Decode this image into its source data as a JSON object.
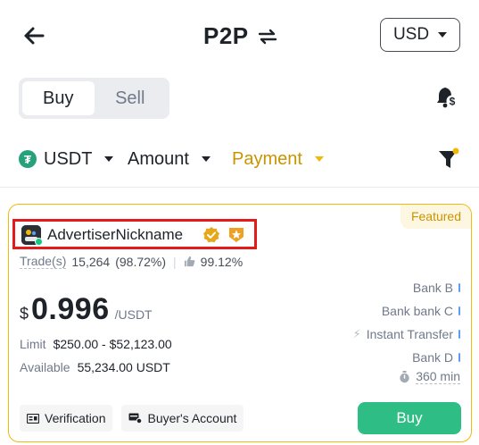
{
  "header": {
    "title": "P2P",
    "currency": "USD"
  },
  "toggle": {
    "buy_label": "Buy",
    "sell_label": "Sell"
  },
  "filters": {
    "asset": "USDT",
    "amount": "Amount",
    "payment": "Payment"
  },
  "card": {
    "featured_label": "Featured",
    "advertiser_name": "AdvertiserNickname",
    "trades_label": "Trade(s)",
    "trades_count": "15,264",
    "completion_rate": "(98.72%)",
    "positive_rate": "99.12%",
    "price_currency_symbol": "$",
    "price": "0.996",
    "price_unit": "/USDT",
    "limit_label": "Limit",
    "limit_value": "$250.00 - $52,123.00",
    "available_label": "Available",
    "available_value": "55,234.00 USDT",
    "payment_methods": [
      "Bank B",
      "Bank bank C",
      "Instant Transfer",
      "Bank D"
    ],
    "payment_time": "360 min",
    "tag_verification": "Verification",
    "tag_buyers_account": "Buyer's Account",
    "buy_button": "Buy"
  },
  "colors": {
    "accent": "#f0b90b",
    "buy_green": "#2ebd85",
    "highlight_red": "#e21b1b",
    "method_bar": "#5a9cf8"
  },
  "icons": [
    "arrow-left-icon",
    "swap-icon",
    "chevron-down-icon",
    "bell-dollar-icon",
    "tether-icon",
    "filter-funnel-icon",
    "verified-badge-icon",
    "shield-badge-icon",
    "thumbs-up-icon",
    "lightning-icon",
    "stopwatch-icon",
    "id-card-icon",
    "account-card-icon"
  ]
}
